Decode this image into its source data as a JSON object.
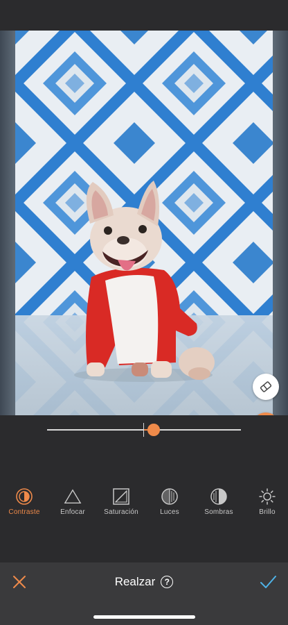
{
  "colors": {
    "accent": "#ef8a4a",
    "confirm": "#4fb3e8",
    "background": "#2b2b2d",
    "bottom_bar": "#3a3a3c"
  },
  "photo": {
    "subject": "french-bulldog-in-red-white-raglan-shirt"
  },
  "floating_buttons": {
    "eraser_icon": "eraser-icon",
    "compare_icon": "split-compare-icon"
  },
  "slider": {
    "value": 0.55
  },
  "tools": [
    {
      "label": "Contraste",
      "icon": "contrast-icon",
      "active": true
    },
    {
      "label": "Enfocar",
      "icon": "triangle-icon",
      "active": false
    },
    {
      "label": "Saturación",
      "icon": "saturation-icon",
      "active": false
    },
    {
      "label": "Luces",
      "icon": "highlights-icon",
      "active": false
    },
    {
      "label": "Sombras",
      "icon": "shadows-icon",
      "active": false
    },
    {
      "label": "Brillo",
      "icon": "sun-icon",
      "active": false
    }
  ],
  "bottom_bar": {
    "title": "Realzar",
    "help_glyph": "?",
    "cancel_icon": "close-icon",
    "confirm_icon": "checkmark-icon"
  }
}
